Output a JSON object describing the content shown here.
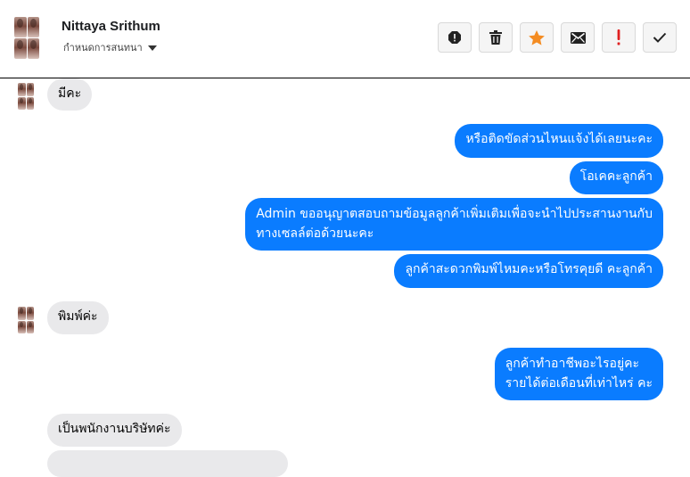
{
  "header": {
    "name": "Nittaya Srithum",
    "status": "กำหนดการสนทนา"
  },
  "actions": [
    {
      "name": "report-icon"
    },
    {
      "name": "trash-icon"
    },
    {
      "name": "star-icon",
      "color": "#f48c22"
    },
    {
      "name": "mail-icon"
    },
    {
      "name": "exclamation-icon",
      "color": "#e02020"
    },
    {
      "name": "check-icon"
    }
  ],
  "messages": [
    {
      "from": "customer",
      "text": "มีคะ"
    },
    {
      "from": "page",
      "text": "หรือติดขัดส่วนไหนแจ้งได้เลยนะคะ"
    },
    {
      "from": "page",
      "text": "โอเคคะลูกค้า"
    },
    {
      "from": "page",
      "lines": [
        "Admin ขออนุญาตสอบถามข้อมูลลูกค้าเพิ่มเติมเพื่อจะนำไปประสานงานกับ",
        "ทางเซลล์ต่อด้วยนะคะ"
      ]
    },
    {
      "from": "page",
      "text": "ลูกค้าสะดวกพิมพ์ไหมคะหรือโทรคุยดี คะลูกค้า"
    },
    {
      "from": "customer",
      "text": "พิมพ์ค่ะ"
    },
    {
      "from": "page",
      "lines": [
        "ลูกค้าทำอาชีพอะไรอยู่คะ",
        "รายได้ต่อเดือนที่เท่าไหร่ คะ"
      ]
    },
    {
      "from": "customer",
      "text": "เป็นพนักงานบริษัทค่ะ"
    }
  ],
  "colors": {
    "outgoing": "#0a7cff",
    "incoming": "#e9e9eb"
  }
}
